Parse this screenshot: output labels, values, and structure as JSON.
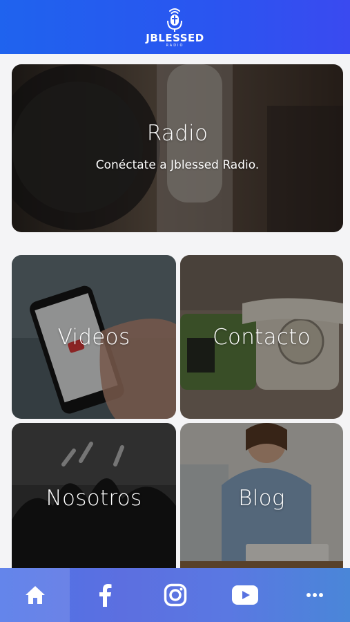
{
  "header": {
    "logo_name": "JBLESSED",
    "logo_sub": "RADIO"
  },
  "tiles": {
    "radio": {
      "title": "Radio",
      "subtitle": "Conéctate a Jblessed Radio."
    },
    "videos": {
      "title": "Videos"
    },
    "contact": {
      "title": "Contacto"
    },
    "about": {
      "title": "Nosotros"
    },
    "blog": {
      "title": "Blog"
    }
  },
  "bottom_nav": {
    "items": [
      {
        "icon": "home-icon",
        "active": true
      },
      {
        "icon": "facebook-icon",
        "active": false
      },
      {
        "icon": "instagram-icon",
        "active": false
      },
      {
        "icon": "youtube-icon",
        "active": false
      },
      {
        "icon": "more-icon",
        "active": false
      }
    ]
  },
  "colors": {
    "header_blue": "#1f63ee",
    "nav_blue": "#5a72e2",
    "background": "#f4f4f6"
  }
}
